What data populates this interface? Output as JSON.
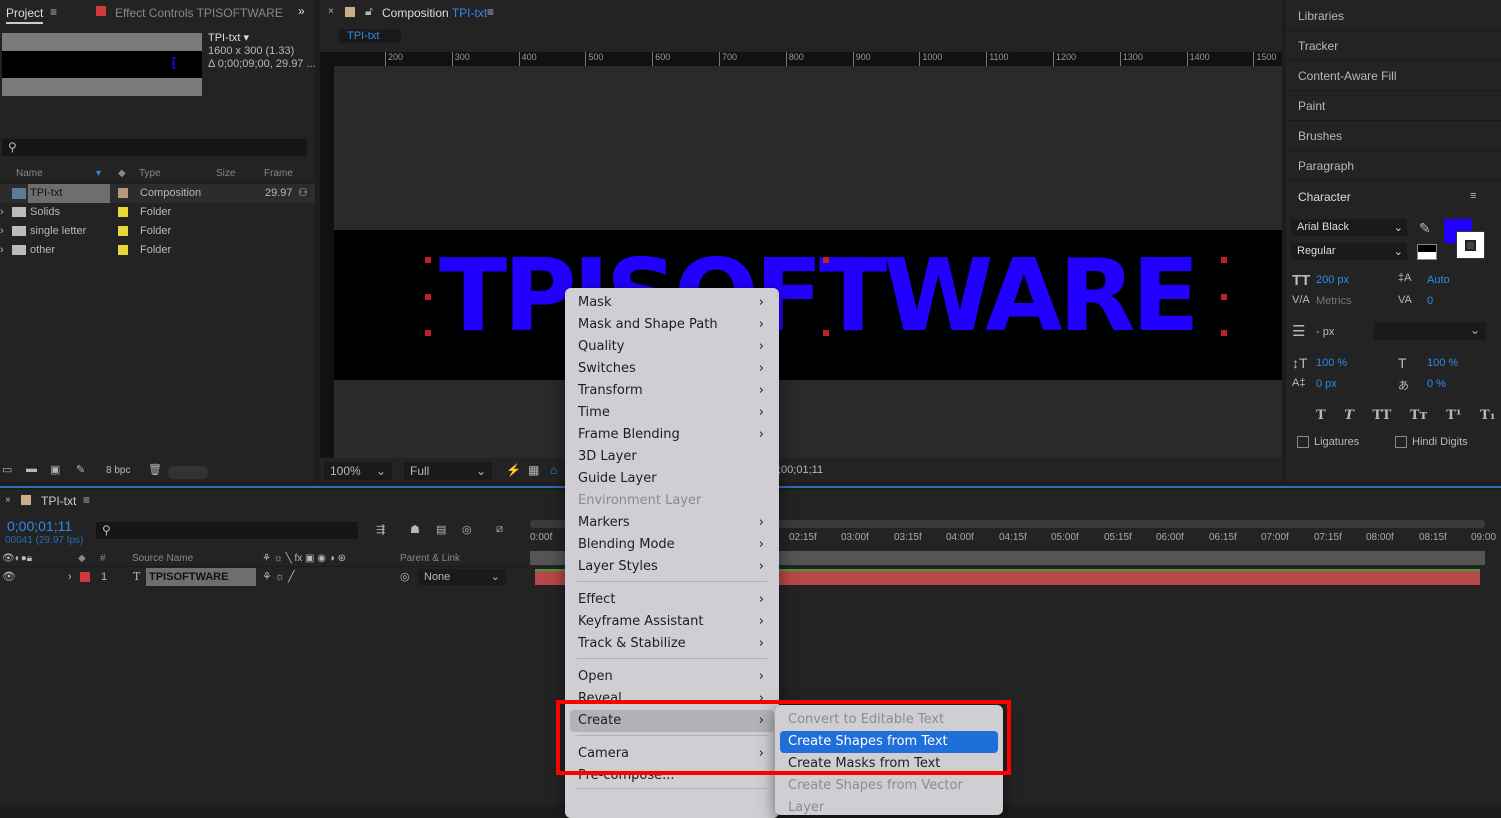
{
  "project": {
    "tab": "Project",
    "effect_tab": "Effect Controls TPISOFTWARE",
    "thumb_name": "TPI-txt ▾",
    "thumb_size": "1600 x 300 (1.33)",
    "thumb_dur": "Δ 0;00;09;00, 29.97 ...",
    "columns": [
      "Name",
      "Type",
      "Size",
      "Frame Ra..."
    ],
    "items": [
      {
        "name": "TPI-txt",
        "type": "Composition",
        "fps": "29.97",
        "label_color": "#b39b7a"
      },
      {
        "name": "Solids",
        "type": "Folder",
        "label_color": "#e6d837"
      },
      {
        "name": "single letter",
        "type": "Folder",
        "label_color": "#e6d837"
      },
      {
        "name": "other",
        "type": "Folder",
        "label_color": "#e6d837"
      }
    ],
    "bpc": "8 bpc"
  },
  "comp": {
    "tab_prefix": "Composition",
    "tab_name": "TPI-txt",
    "subtab": "TPI-txt",
    "ruler": [
      "200",
      "300",
      "400",
      "500",
      "600",
      "700",
      "800",
      "900",
      "1000",
      "1100",
      "1200",
      "1300",
      "1400",
      "1500"
    ],
    "text": "TPISOFTWARE",
    "text_color": "#2200ff",
    "zoom": "100%",
    "resolution": "Full",
    "timecode": ";00;01;11"
  },
  "right": {
    "items": [
      "Libraries",
      "Tracker",
      "Content-Aware Fill",
      "Paint",
      "Brushes",
      "Paragraph"
    ],
    "character": {
      "title": "Character",
      "font": "Arial Black",
      "style": "Regular",
      "size": "200 px",
      "leading": "Auto",
      "kerning": "Metrics",
      "tracking": "0",
      "stroke": "- px",
      "vscale": "100 %",
      "hscale": "100 %",
      "baseline": "0 px",
      "tsume": "0 %",
      "ligatures": "Ligatures",
      "hindi": "Hindi Digits",
      "fill_color": "#2200ff"
    }
  },
  "timeline": {
    "tab": "TPI-txt",
    "timecode": "0;00;01;11",
    "frames": "00041 (29.97 fps)",
    "cols": {
      "num": "#",
      "source": "Source Name",
      "parent": "Parent & Link"
    },
    "layer": {
      "num": "1",
      "name": "TPISOFTWARE",
      "parent": "None"
    },
    "ruler": [
      "0:00f",
      "02:15f",
      "03:00f",
      "03:15f",
      "04:00f",
      "04:15f",
      "05:00f",
      "05:15f",
      "06:00f",
      "06:15f",
      "07:00f",
      "07:15f",
      "08:00f",
      "08:15f",
      "09:00"
    ]
  },
  "menu": {
    "items": [
      {
        "label": "Mask",
        "sub": true
      },
      {
        "label": "Mask and Shape Path",
        "sub": true
      },
      {
        "label": "Quality",
        "sub": true
      },
      {
        "label": "Switches",
        "sub": true
      },
      {
        "label": "Transform",
        "sub": true
      },
      {
        "label": "Time",
        "sub": true
      },
      {
        "label": "Frame Blending",
        "sub": true
      },
      {
        "label": "3D Layer"
      },
      {
        "label": "Guide Layer"
      },
      {
        "label": "Environment Layer",
        "disabled": true
      },
      {
        "label": "Markers",
        "sub": true
      },
      {
        "label": "Blending Mode",
        "sub": true
      },
      {
        "label": "Layer Styles",
        "sub": true
      },
      {
        "label": "Effect",
        "sub": true
      },
      {
        "label": "Keyframe Assistant",
        "sub": true
      },
      {
        "label": "Track & Stabilize",
        "sub": true
      },
      {
        "label": "Open",
        "sub": true
      },
      {
        "label": "Reveal",
        "sub": true
      },
      {
        "label": "Create",
        "sub": true,
        "highlighted": true
      },
      {
        "label": "Camera",
        "sub": true
      },
      {
        "label": "Pre-compose..."
      }
    ],
    "submenu": [
      {
        "label": "Convert to Editable Text",
        "disabled": true
      },
      {
        "label": "Create Shapes from Text",
        "selected": true
      },
      {
        "label": "Create Masks from Text"
      },
      {
        "label": "Create Shapes from Vector Layer",
        "disabled": true
      }
    ]
  }
}
